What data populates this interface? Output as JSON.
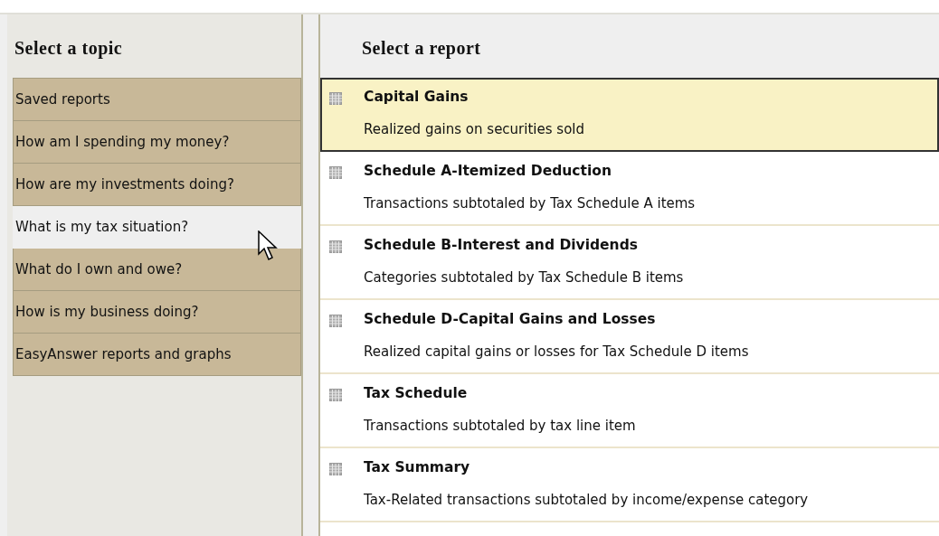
{
  "topics_panel": {
    "heading": "Select a topic",
    "topics": [
      {
        "label": "Saved reports",
        "selected": false
      },
      {
        "label": "How am I spending my money?",
        "selected": false
      },
      {
        "label": "How are my investments doing?",
        "selected": false
      },
      {
        "label": "What is my tax situation?",
        "selected": true
      },
      {
        "label": "What do I own and owe?",
        "selected": false
      },
      {
        "label": "How is my business doing?",
        "selected": false
      },
      {
        "label": "EasyAnswer reports and graphs",
        "selected": false
      }
    ]
  },
  "reports_panel": {
    "heading": "Select a report",
    "reports": [
      {
        "title": "Capital Gains",
        "description": "Realized gains on securities sold",
        "selected": true
      },
      {
        "title": "Schedule A-Itemized Deduction",
        "description": "Transactions subtotaled by Tax Schedule A items",
        "selected": false
      },
      {
        "title": "Schedule B-Interest and Dividends",
        "description": "Categories subtotaled by Tax Schedule B items",
        "selected": false
      },
      {
        "title": "Schedule D-Capital Gains and Losses",
        "description": "Realized capital gains or losses for Tax Schedule D items",
        "selected": false
      },
      {
        "title": "Tax Schedule",
        "description": "Transactions subtotaled by tax line item",
        "selected": false
      },
      {
        "title": "Tax Summary",
        "description": "Tax-Related transactions subtotaled by income/expense category",
        "selected": false
      }
    ]
  }
}
